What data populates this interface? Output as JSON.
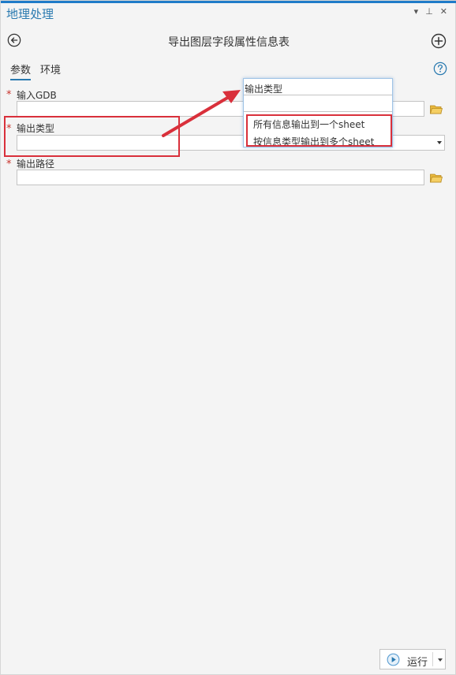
{
  "pane": {
    "title": "地理处理",
    "controls": {
      "dropdown": "▾",
      "pin": "⊥",
      "close": "✕"
    }
  },
  "tool": {
    "title": "导出图层字段属性信息表",
    "back_icon": "back-arrow-circle-icon",
    "add_icon": "plus-circle-icon"
  },
  "tabs": [
    {
      "label": "参数",
      "active": true
    },
    {
      "label": "环境",
      "active": false
    }
  ],
  "help_icon": "question-circle-icon",
  "params": [
    {
      "label": "输入GDB",
      "value": "",
      "required_mark": "*",
      "browse_icon": "folder-icon"
    },
    {
      "label": "输出类型",
      "value": "",
      "required_mark": "*",
      "dropdown_icon": "caret-down-icon"
    },
    {
      "label": "输出路径",
      "value": "",
      "required_mark": "*",
      "browse_icon": "folder-icon"
    }
  ],
  "popup": {
    "title": "输出类型",
    "input_value": "",
    "options": [
      "所有信息输出到一个sheet",
      "按信息类型输出到多个sheet"
    ]
  },
  "run": {
    "label": "运行",
    "icon": "play-circle-icon"
  },
  "colors": {
    "accent": "#2a7ab0",
    "highlight": "#d9303b",
    "required": "#c8322b"
  }
}
